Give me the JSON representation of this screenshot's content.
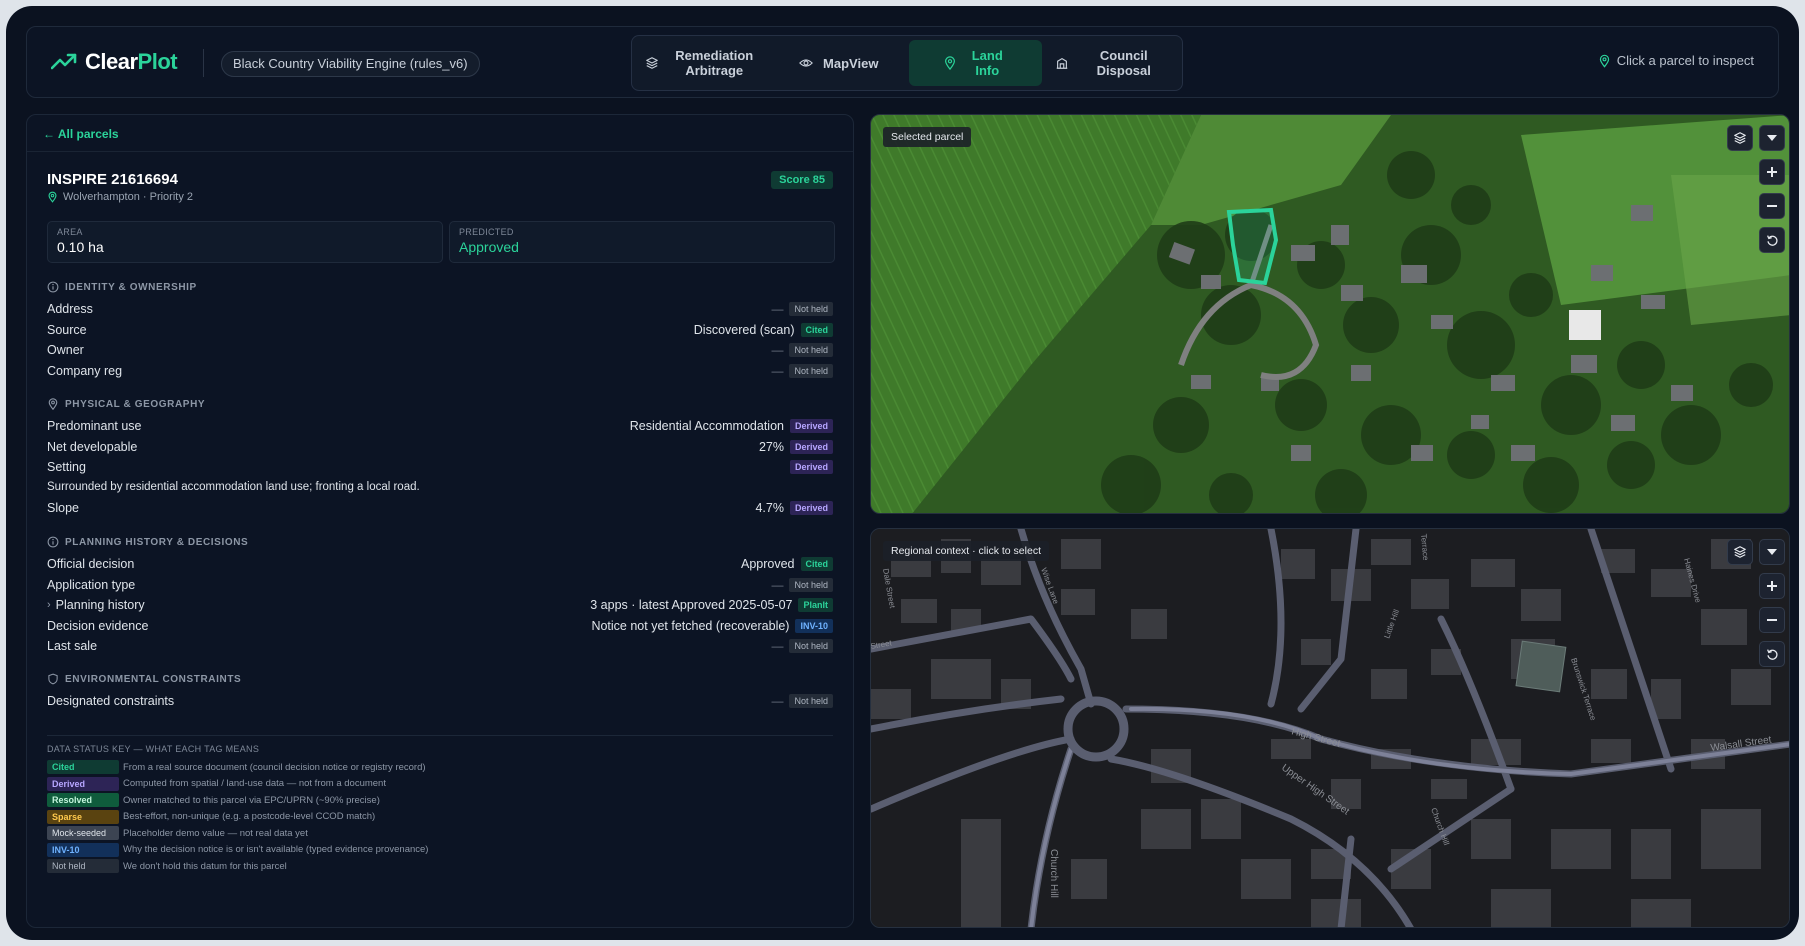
{
  "app": {
    "logo_main": "Clear",
    "logo_accent": "Plot",
    "engine": "Black Country Viability Engine (rules_v6)",
    "inspect_hint": "Click a parcel to inspect"
  },
  "tabs": [
    {
      "label": "Remediation Arbitrage",
      "icon": "layers-icon",
      "active": false
    },
    {
      "label": "MapView",
      "icon": "eye-icon",
      "active": false
    },
    {
      "label": "Land Info",
      "icon": "map-pin-icon",
      "active": true
    },
    {
      "label": "Council Disposal",
      "icon": "building-icon",
      "active": false
    }
  ],
  "panel": {
    "back": "← All parcels",
    "title": "INSPIRE 21616694",
    "score": "Score 85",
    "location": "Wolverhampton · Priority 2",
    "area_label": "AREA",
    "area_value": "0.10 ha",
    "predicted_label": "PREDICTED",
    "predicted_value": "Approved"
  },
  "identity": {
    "heading": "IDENTITY & OWNERSHIP",
    "address": {
      "label": "Address",
      "value": "—",
      "tag": "Not held"
    },
    "source": {
      "label": "Source",
      "value": "Discovered (scan)",
      "tag": "Cited"
    },
    "owner": {
      "label": "Owner",
      "value": "—",
      "tag": "Not held"
    },
    "company": {
      "label": "Company reg",
      "value": "—",
      "tag": "Not held"
    }
  },
  "physical": {
    "heading": "PHYSICAL & GEOGRAPHY",
    "use": {
      "label": "Predominant use",
      "value": "Residential Accommodation",
      "tag": "Derived"
    },
    "net": {
      "label": "Net developable",
      "value": "27%",
      "tag": "Derived"
    },
    "setting": {
      "label": "Setting",
      "tag": "Derived",
      "note": "Surrounded by residential accommodation land use; fronting a local road."
    },
    "slope": {
      "label": "Slope",
      "value": "4.7%",
      "tag": "Derived"
    }
  },
  "planning": {
    "heading": "PLANNING HISTORY & DECISIONS",
    "official": {
      "label": "Official decision",
      "value": "Approved",
      "tag": "Cited"
    },
    "apptype": {
      "label": "Application type",
      "value": "—",
      "tag": "Not held"
    },
    "history": {
      "label": "Planning history",
      "value": "3 apps · latest Approved 2025-05-07",
      "tag": "PlanIt"
    },
    "evidence": {
      "label": "Decision evidence",
      "value": "Notice not yet fetched (recoverable)",
      "tag": "INV-10"
    },
    "lastsale": {
      "label": "Last sale",
      "value": "—",
      "tag": "Not held"
    }
  },
  "environment": {
    "heading": "ENVIRONMENTAL CONSTRAINTS",
    "designated": {
      "label": "Designated constraints",
      "value": "—",
      "tag": "Not held"
    }
  },
  "key": {
    "heading": "DATA STATUS KEY — WHAT EACH TAG MEANS",
    "items": [
      {
        "tag": "Cited",
        "desc": "From a real source document (council decision notice or registry record)"
      },
      {
        "tag": "Derived",
        "desc": "Computed from spatial / land-use data — not from a document"
      },
      {
        "tag": "Resolved",
        "desc": "Owner matched to this parcel via EPC/UPRN (~90% precise)"
      },
      {
        "tag": "Sparse",
        "desc": "Best-effort, non-unique (e.g. a postcode-level CCOD match)"
      },
      {
        "tag": "Mock-seeded",
        "desc": "Placeholder demo value — not real data yet"
      },
      {
        "tag": "INV-10",
        "desc": "Why the decision notice is or isn't available (typed evidence provenance)"
      },
      {
        "tag": "Not held",
        "desc": "We don't hold this datum for this parcel"
      }
    ]
  },
  "maps": {
    "satellite_label": "Selected parcel",
    "context_label": "Regional context · click to select",
    "streets": [
      "Dale Street",
      "Wise Lane",
      "Terrace",
      "Little Hill",
      "Haines Drive",
      "Street",
      "Brunswick Terrace",
      "High Street",
      "Walsall Street",
      "Upper High Street",
      "Church Hill",
      "Church Hill"
    ]
  },
  "colors": {
    "accent": "#2bd39a",
    "background": "#0b1220"
  }
}
